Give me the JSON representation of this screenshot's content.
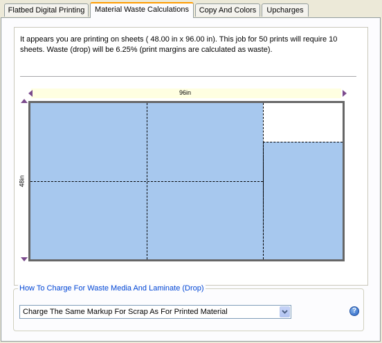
{
  "tabs": [
    {
      "label": "Flatbed Digital Printing"
    },
    {
      "label": "Material Waste Calculations"
    },
    {
      "label": "Copy And Colors"
    },
    {
      "label": "Upcharges"
    }
  ],
  "info": {
    "line1": "It appears you are printing on sheets (   48.00 in x   96.00 in).  This job for 50 prints will require 10",
    "line2": "sheets.  Waste (drop) will be 6.25% (print margins are calculated as waste)."
  },
  "diagram": {
    "width_label": "96in",
    "height_label": "48in",
    "colors": {
      "piece": "#A7C8EE",
      "sheet_border": "#666666",
      "dimension_bar": "#FFFFE1",
      "arrow": "#7B4A8C"
    }
  },
  "waste_group": {
    "legend": "How To Charge For Waste Media And Laminate (Drop)",
    "selected_option": "Charge The Same Markup For Scrap As For Printed Material",
    "help_icon": "?"
  },
  "colors": {
    "tab_active_accent": "#FF9C00",
    "group_legend": "#0046D5"
  }
}
